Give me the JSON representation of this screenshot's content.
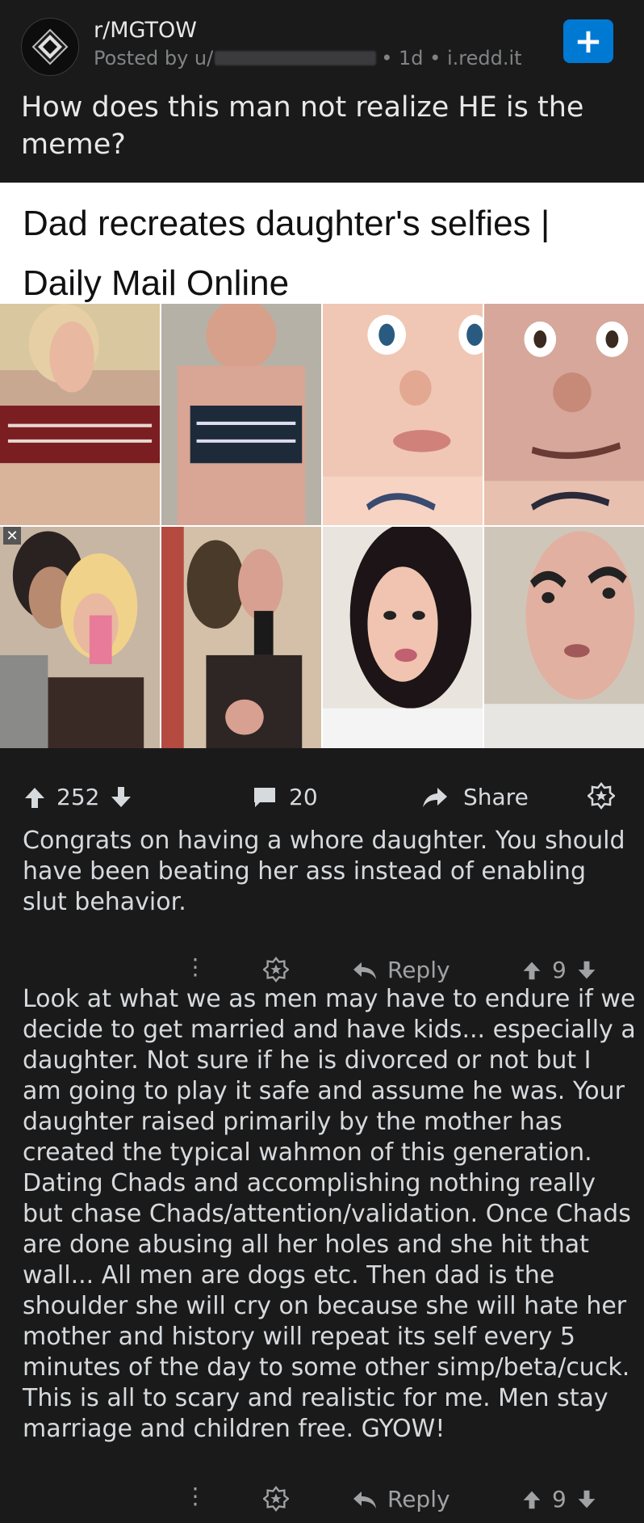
{
  "post": {
    "subreddit": "r/MGTOW",
    "posted_by_prefix": "Posted by u/",
    "age": "1d",
    "domain": "i.redd.it",
    "title": "How does this man not realize HE is the meme?",
    "join_label": "+"
  },
  "image": {
    "headline": "Dad recreates daughter's selfies | Daily Mail Online"
  },
  "actions": {
    "score": "252",
    "comments": "20",
    "share_label": "Share"
  },
  "comments": [
    {
      "text": "Congrats on having a whore daughter. You should have been beating her ass instead of enabling slut behavior.",
      "reply_label": "Reply",
      "score": "9"
    },
    {
      "text": "Look at what we as men may have to endure if we decide to get married and have kids... especially a daughter. Not sure if he is divorced or not but I am going to play it safe and assume he was. Your daughter raised primarily by the mother has created the typical wahmon of this generation. Dating Chads and accomplishing nothing really but chase Chads/attention/validation. Once Chads are done abusing all her holes and she hit that wall... All men are dogs etc. Then dad is the shoulder she will cry on because she will hate her mother and history will repeat its self every 5 minutes of the day to some other simp/beta/cuck. This is all to scary and realistic for me. Men stay marriage and children free. GYOW!",
      "reply_label": "Reply",
      "score": "9"
    }
  ],
  "colors": {
    "background": "#1a1a1b",
    "text": "#d7dadc",
    "muted": "#818384",
    "accent": "#0079d3"
  }
}
